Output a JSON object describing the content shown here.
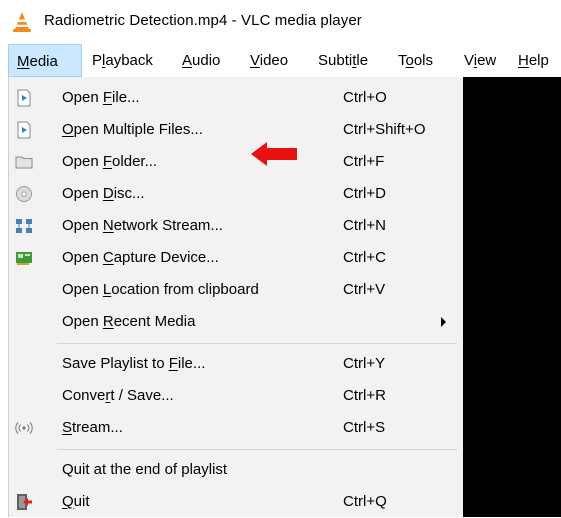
{
  "window": {
    "title": "Radiometric Detection.mp4 - VLC media player"
  },
  "menubar": [
    {
      "label": "Media",
      "ul": "M",
      "rest": "edia",
      "pre": "",
      "active": true
    },
    {
      "label": "Playback",
      "pre": "P",
      "ul": "l",
      "rest": "ayback"
    },
    {
      "label": "Audio",
      "pre": "",
      "ul": "A",
      "rest": "udio"
    },
    {
      "label": "Video",
      "pre": "",
      "ul": "V",
      "rest": "ideo"
    },
    {
      "label": "Subtitle",
      "pre": "Subti",
      "ul": "t",
      "rest": "le"
    },
    {
      "label": "Tools",
      "pre": "T",
      "ul": "o",
      "rest": "ols"
    },
    {
      "label": "View",
      "pre": "V",
      "ul": "i",
      "rest": "ew"
    },
    {
      "label": "Help",
      "pre": "",
      "ul": "H",
      "rest": "elp"
    }
  ],
  "media_menu": {
    "open_file": {
      "pre": "Open ",
      "ul": "F",
      "rest": "ile...",
      "shortcut": "Ctrl+O"
    },
    "open_multiple": {
      "pre": "",
      "ul": "O",
      "rest": "pen Multiple Files...",
      "shortcut": "Ctrl+Shift+O"
    },
    "open_folder": {
      "pre": "Open ",
      "ul": "F",
      "rest": "older...",
      "shortcut": "Ctrl+F"
    },
    "open_disc": {
      "pre": "Open ",
      "ul": "D",
      "rest": "isc...",
      "shortcut": "Ctrl+D"
    },
    "open_network": {
      "pre": "Open ",
      "ul": "N",
      "rest": "etwork Stream...",
      "shortcut": "Ctrl+N"
    },
    "open_capture": {
      "pre": "Open ",
      "ul": "C",
      "rest": "apture Device...",
      "shortcut": "Ctrl+C"
    },
    "open_location": {
      "pre": "Open ",
      "ul": "L",
      "rest": "ocation from clipboard",
      "shortcut": "Ctrl+V"
    },
    "open_recent": {
      "pre": "Open ",
      "ul": "R",
      "rest": "ecent Media",
      "shortcut": ""
    },
    "save_playlist": {
      "pre": "Save Playlist to ",
      "ul": "F",
      "rest": "ile...",
      "shortcut": "Ctrl+Y"
    },
    "convert_save": {
      "pre": "Conve",
      "ul": "r",
      "rest": "t / Save...",
      "shortcut": "Ctrl+R"
    },
    "stream": {
      "pre": "",
      "ul": "S",
      "rest": "tream...",
      "shortcut": "Ctrl+S"
    },
    "quit_end": {
      "pre": "Quit at the end of playlist",
      "ul": "",
      "rest": "",
      "shortcut": ""
    },
    "quit": {
      "pre": "",
      "ul": "Q",
      "rest": "uit",
      "shortcut": "Ctrl+Q"
    }
  },
  "colors": {
    "menubar_active_bg": "#cce8ff",
    "dropdown_bg": "#f2f2f2",
    "annotation_arrow": "#e81010",
    "video_bg": "#000000"
  }
}
